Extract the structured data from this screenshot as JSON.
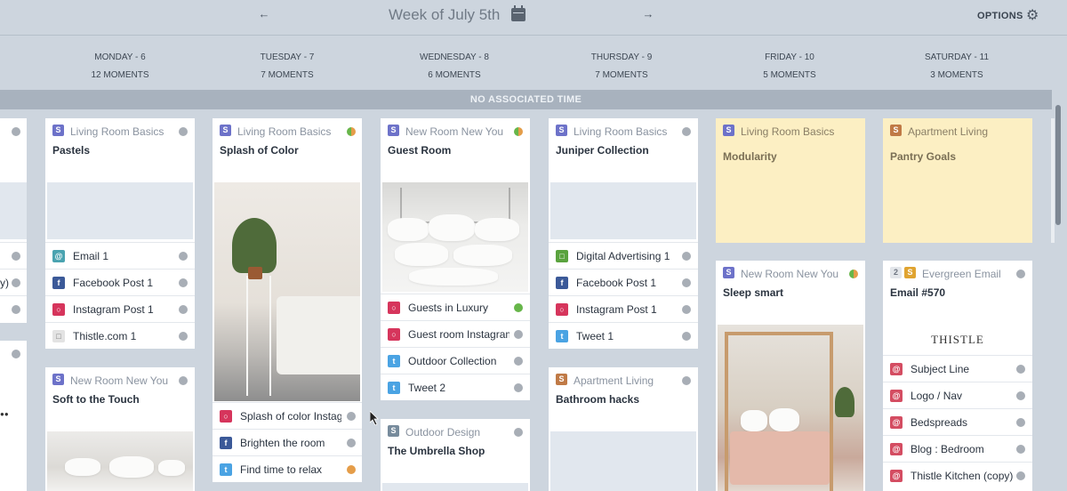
{
  "header": {
    "week_title": "Week of July 5th",
    "options_label": "OPTIONS",
    "prev_icon": "arrow-left",
    "next_icon": "arrow-right",
    "calendar_icon": "calendar",
    "gear_icon": "gear"
  },
  "days": [
    {
      "name": "MONDAY - 6",
      "count": "12 MOMENTS"
    },
    {
      "name": "TUESDAY - 7",
      "count": "7 MOMENTS"
    },
    {
      "name": "WEDNESDAY - 8",
      "count": "6 MOMENTS"
    },
    {
      "name": "THURSDAY - 9",
      "count": "7 MOMENTS"
    },
    {
      "name": "FRIDAY - 10",
      "count": "5 MOMENTS"
    },
    {
      "name": "SATURDAY - 11",
      "count": "3 MOMENTS"
    }
  ],
  "no_associated_time": "NO ASSOCIATED TIME",
  "partial_col": {
    "items": [
      "y)"
    ]
  },
  "cards": {
    "mon1": {
      "badge": "S",
      "campaign": "Living Room Basics",
      "title": "Pastels",
      "items": [
        "Email 1",
        "Facebook Post 1",
        "Instagram Post 1",
        "Thistle.com 1"
      ]
    },
    "mon2": {
      "badge": "S",
      "campaign": "New Room New You",
      "title": "Soft to the Touch"
    },
    "tue1": {
      "badge": "S",
      "campaign": "Living Room Basics",
      "title": "Splash of Color",
      "items": [
        "Splash of color Instag",
        "Brighten the room",
        "Find time to relax"
      ]
    },
    "wed1": {
      "badge": "S",
      "campaign": "New Room New You",
      "title": "Guest Room",
      "items": [
        "Guests in Luxury",
        "Guest room Instagram",
        "Outdoor Collection",
        "Tweet 2"
      ]
    },
    "wed2": {
      "badge": "S",
      "campaign": "Outdoor Design",
      "title": "The Umbrella Shop"
    },
    "thu1": {
      "badge": "S",
      "campaign": "Living Room Basics",
      "title": "Juniper Collection",
      "items": [
        "Digital Advertising 1",
        "Facebook Post 1",
        "Instagram Post 1",
        "Tweet 1"
      ]
    },
    "thu2": {
      "badge": "S",
      "campaign": "Apartment Living",
      "title": "Bathroom hacks"
    },
    "fri1": {
      "badge": "S",
      "campaign": "Living Room Basics",
      "title": "Modularity"
    },
    "fri2": {
      "badge": "S",
      "campaign": "New Room New You",
      "title": "Sleep smart"
    },
    "sat1": {
      "badge": "S",
      "campaign": "Apartment Living",
      "title": "Pantry Goals"
    },
    "sat2": {
      "badge_count": "2",
      "badge": "S",
      "campaign": "Evergreen Email",
      "title": "Email #570",
      "logo_text": "THISTLE",
      "items": [
        "Subject Line",
        "Logo / Nav",
        "Bedspreads",
        "Blog : Bedroom",
        "Thistle Kitchen (copy)"
      ]
    }
  },
  "colors": {
    "background": "#cdd5de",
    "strategy_badge": "#6d72c9",
    "apartment_badge": "#c07a46",
    "yellow_card": "#fcefc3",
    "status_gray": "#a8aeb6",
    "status_green": "#67b64a",
    "status_orange": "#e59d49"
  }
}
